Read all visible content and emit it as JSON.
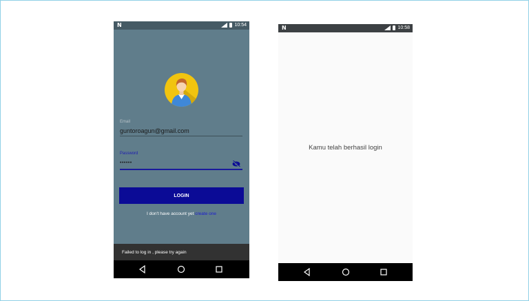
{
  "screen1": {
    "status_time": "10:54",
    "email_label": "Email",
    "email_value": "guntoroagun@gmail.com",
    "password_label": "Password",
    "password_value": "••••••",
    "login_label": "LOGIN",
    "no_account_text": "I don't have account yet",
    "create_link": "create one",
    "snackbar_text": "Failed to log in , please try again"
  },
  "screen2": {
    "status_time": "10:58",
    "message": "Kamu telah berhasil login"
  },
  "colors": {
    "background": "#607d8b",
    "accent": "#0b0b96",
    "avatar_bg": "#f1c40f"
  },
  "icons": [
    "app-notification-icon",
    "signal-icon",
    "battery-icon",
    "user-avatar-icon",
    "eye-off-icon",
    "back-icon",
    "home-icon",
    "recents-icon"
  ]
}
